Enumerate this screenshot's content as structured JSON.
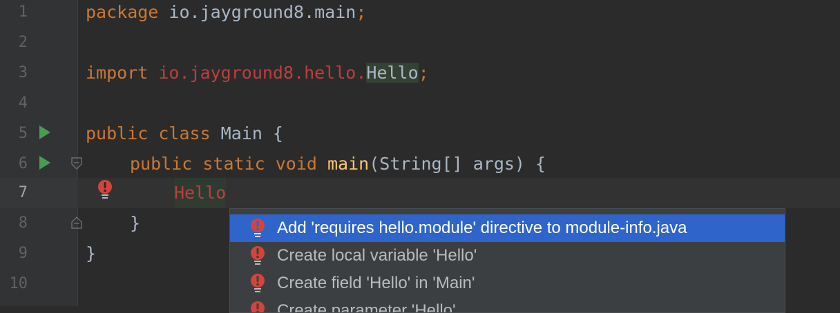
{
  "line_numbers": [
    "1",
    "2",
    "3",
    "4",
    "5",
    "6",
    "7",
    "8",
    "9",
    "10"
  ],
  "code": {
    "l1": {
      "kw": "package",
      "pkg": " io.jayground8.main",
      "semi": ";"
    },
    "l3": {
      "kw": "import",
      "pkg_red": " io.jayground8.hello.",
      "cls": "Hello",
      "semi": ";"
    },
    "l5": {
      "kw": "public class",
      "name": " Main {"
    },
    "l6": {
      "kw": "public static void",
      "fn": "main",
      "rest": "(String[] args) {"
    },
    "l7": {
      "word": "Hello"
    },
    "l8": {
      "brace": "}"
    },
    "l9": {
      "brace": "}"
    }
  },
  "intention_menu": {
    "items": [
      {
        "label": "Add 'requires hello.module' directive to module-info.java",
        "selected": true
      },
      {
        "label": "Create local variable 'Hello'"
      },
      {
        "label": "Create field 'Hello' in 'Main'"
      },
      {
        "label": "Create parameter 'Hello'"
      }
    ]
  },
  "colors": {
    "editor_bg": "#2b2b2b",
    "gutter_bg": "#313335",
    "keyword": "#cc7832",
    "error": "#bc3f3c",
    "function": "#ffc66d",
    "selection": "#2f65ca",
    "run_green": "#499c54"
  },
  "icons": {
    "run": "run-gutter-icon",
    "fold": "fold-marker-icon",
    "bulb": "red-bulb-icon"
  }
}
